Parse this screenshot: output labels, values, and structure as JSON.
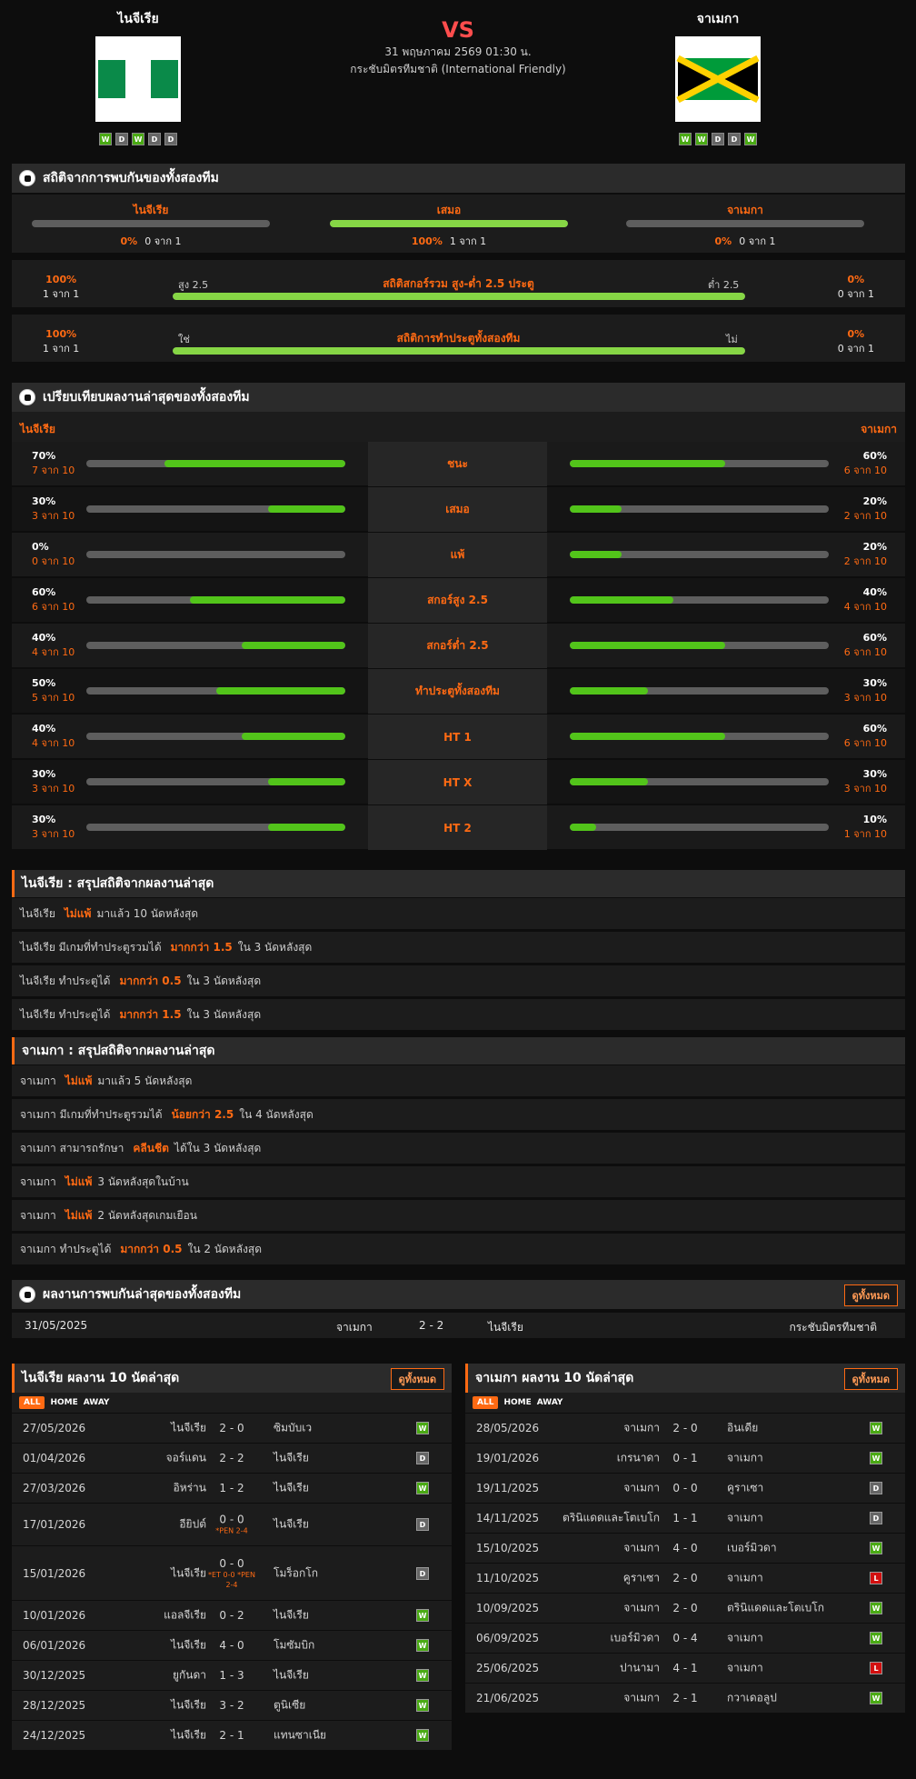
{
  "header": {
    "home": "ไนจีเรีย",
    "away": "จาเมกา",
    "vs": "VS",
    "date": "31 พฤษภาคม 2569 01:30 น.",
    "competition": "กระชับมิตรทีมชาติ (International Friendly)",
    "home_form": [
      "W",
      "D",
      "W",
      "D",
      "D"
    ],
    "away_form": [
      "W",
      "W",
      "D",
      "D",
      "W"
    ]
  },
  "h2h": {
    "title": "สถิติจากการพบกันของทั้งสองทีม",
    "cols": [
      {
        "label": "ไนจีเรีย",
        "pct": "0%",
        "cnt": "0 จาก 1",
        "val": 0
      },
      {
        "label": "เสมอ",
        "pct": "100%",
        "cnt": "1 จาก 1",
        "val": 100
      },
      {
        "label": "จาเมกา",
        "pct": "0%",
        "cnt": "0 จาก 1",
        "val": 0
      }
    ],
    "over": {
      "lpct": "100%",
      "lcnt": "1 จาก 1",
      "left": "สูง 2.5",
      "title": "สถิติสกอร์รวม สูง-ต่ำ 2.5 ประตู",
      "right": "ต่ำ 2.5",
      "rpct": "0%",
      "rcnt": "0 จาก 1",
      "val": 100
    },
    "btts": {
      "lpct": "100%",
      "lcnt": "1 จาก 1",
      "left": "ใช่",
      "title": "สถิติการทำประตูทั้งสองทีม",
      "right": "ไม่",
      "rpct": "0%",
      "rcnt": "0 จาก 1",
      "val": 100
    }
  },
  "compare": {
    "title": "เปรียบเทียบผลงานล่าสุดของทั้งสองทีม",
    "home": "ไนจีเรีย",
    "away": "จาเมกา",
    "rows": [
      {
        "label": "ชนะ",
        "lp": "70%",
        "lc": "7 จาก 10",
        "rp": "60%",
        "rc": "6 จาก 10",
        "lv": 70,
        "rv": 60
      },
      {
        "label": "เสมอ",
        "lp": "30%",
        "lc": "3 จาก 10",
        "rp": "20%",
        "rc": "2 จาก 10",
        "lv": 30,
        "rv": 20
      },
      {
        "label": "แพ้",
        "lp": "0%",
        "lc": "0 จาก 10",
        "rp": "20%",
        "rc": "2 จาก 10",
        "lv": 0,
        "rv": 20
      },
      {
        "label": "สกอร์สูง 2.5",
        "lp": "60%",
        "lc": "6 จาก 10",
        "rp": "40%",
        "rc": "4 จาก 10",
        "lv": 60,
        "rv": 40
      },
      {
        "label": "สกอร์ต่ำ 2.5",
        "lp": "40%",
        "lc": "4 จาก 10",
        "rp": "60%",
        "rc": "6 จาก 10",
        "lv": 40,
        "rv": 60
      },
      {
        "label": "ทำประตูทั้งสองทีม",
        "lp": "50%",
        "lc": "5 จาก 10",
        "rp": "30%",
        "rc": "3 จาก 10",
        "lv": 50,
        "rv": 30
      },
      {
        "label": "HT 1",
        "lp": "40%",
        "lc": "4 จาก 10",
        "rp": "60%",
        "rc": "6 จาก 10",
        "lv": 40,
        "rv": 60
      },
      {
        "label": "HT X",
        "lp": "30%",
        "lc": "3 จาก 10",
        "rp": "30%",
        "rc": "3 จาก 10",
        "lv": 30,
        "rv": 30
      },
      {
        "label": "HT 2",
        "lp": "30%",
        "lc": "3 จาก 10",
        "rp": "10%",
        "rc": "1 จาก 10",
        "lv": 30,
        "rv": 10
      }
    ]
  },
  "sum_home": {
    "title": "ไนจีเรีย : สรุปสถิติจากผลงานล่าสุด",
    "rows": [
      [
        "ไนจีเรีย",
        "ไม่แพ้",
        "มาแล้ว 10 นัดหลังสุด"
      ],
      [
        "ไนจีเรีย มีเกมที่ทำประตูรวมได้",
        "มากกว่า 1.5",
        "ใน 3 นัดหลังสุด"
      ],
      [
        "ไนจีเรีย ทำประตูได้",
        "มากกว่า 0.5",
        "ใน 3 นัดหลังสุด"
      ],
      [
        "ไนจีเรีย ทำประตูได้",
        "มากกว่า 1.5",
        "ใน 3 นัดหลังสุด"
      ]
    ]
  },
  "sum_away": {
    "title": "จาเมกา : สรุปสถิติจากผลงานล่าสุด",
    "rows": [
      [
        "จาเมกา",
        "ไม่แพ้",
        "มาแล้ว 5 นัดหลังสุด"
      ],
      [
        "จาเมกา มีเกมที่ทำประตูรวมได้",
        "น้อยกว่า 2.5",
        "ใน 4 นัดหลังสุด"
      ],
      [
        "จาเมกา สามารถรักษา",
        "คลีนชีต",
        "ได้ใน 3 นัดหลังสุด"
      ],
      [
        "จาเมกา",
        "ไม่แพ้",
        "3 นัดหลังสุดในบ้าน"
      ],
      [
        "จาเมกา",
        "ไม่แพ้",
        "2 นัดหลังสุดเกมเยือน"
      ],
      [
        "จาเมกา ทำประตูได้",
        "มากกว่า 0.5",
        "ใน 2 นัดหลังสุด"
      ]
    ]
  },
  "h2h_list": {
    "title": "ผลงานการพบกันล่าสุดของทั้งสองทีม",
    "view_all": "ดูทั้งหมด",
    "rows": [
      {
        "date": "31/05/2025",
        "home": "จาเมกา",
        "score": "2 - 2",
        "away": "ไนจีเรีย",
        "comp": "กระชับมิตรทีมชาติ"
      }
    ]
  },
  "home_list": {
    "title": "ไนจีเรีย ผลงาน 10 นัดล่าสุด",
    "view_all": "ดูทั้งหมด",
    "tabs": [
      "ALL",
      "HOME",
      "AWAY"
    ],
    "rows": [
      {
        "date": "27/05/2026",
        "home": "ไนจีเรีย",
        "score": "2 - 0",
        "away": "ซิมบับเว",
        "res": "W"
      },
      {
        "date": "01/04/2026",
        "home": "จอร์แดน",
        "score": "2 - 2",
        "away": "ไนจีเรีย",
        "res": "D"
      },
      {
        "date": "27/03/2026",
        "home": "อิหร่าน",
        "score": "1 - 2",
        "away": "ไนจีเรีย",
        "res": "W"
      },
      {
        "date": "17/01/2026",
        "home": "อียิปต์",
        "score": "0 - 0",
        "pen": "*PEN 2-4",
        "away": "ไนจีเรีย",
        "res": "D"
      },
      {
        "date": "15/01/2026",
        "home": "ไนจีเรีย",
        "score": "0 - 0",
        "pen": "*ET 0-0 *PEN 2-4",
        "away": "โมร็อกโก",
        "res": "D"
      },
      {
        "date": "10/01/2026",
        "home": "แอลจีเรีย",
        "score": "0 - 2",
        "away": "ไนจีเรีย",
        "res": "W"
      },
      {
        "date": "06/01/2026",
        "home": "ไนจีเรีย",
        "score": "4 - 0",
        "away": "โมซัมบิก",
        "res": "W"
      },
      {
        "date": "30/12/2025",
        "home": "ยูกันดา",
        "score": "1 - 3",
        "away": "ไนจีเรีย",
        "res": "W"
      },
      {
        "date": "28/12/2025",
        "home": "ไนจีเรีย",
        "score": "3 - 2",
        "away": "ตูนิเซีย",
        "res": "W"
      },
      {
        "date": "24/12/2025",
        "home": "ไนจีเรีย",
        "score": "2 - 1",
        "away": "แทนซาเนีย",
        "res": "W"
      }
    ]
  },
  "away_list": {
    "title": "จาเมกา ผลงาน 10 นัดล่าสุด",
    "view_all": "ดูทั้งหมด",
    "tabs": [
      "ALL",
      "HOME",
      "AWAY"
    ],
    "rows": [
      {
        "date": "28/05/2026",
        "home": "จาเมกา",
        "score": "2 - 0",
        "away": "อินเดีย",
        "res": "W"
      },
      {
        "date": "19/01/2026",
        "home": "เกรนาดา",
        "score": "0 - 1",
        "away": "จาเมกา",
        "res": "W"
      },
      {
        "date": "19/11/2025",
        "home": "จาเมกา",
        "score": "0 - 0",
        "away": "คูราเซา",
        "res": "D"
      },
      {
        "date": "14/11/2025",
        "home": "ตรินิแดดและโตเบโก",
        "score": "1 - 1",
        "away": "จาเมกา",
        "res": "D"
      },
      {
        "date": "15/10/2025",
        "home": "จาเมกา",
        "score": "4 - 0",
        "away": "เบอร์มิวดา",
        "res": "W"
      },
      {
        "date": "11/10/2025",
        "home": "คูราเซา",
        "score": "2 - 0",
        "away": "จาเมกา",
        "res": "L"
      },
      {
        "date": "10/09/2025",
        "home": "จาเมกา",
        "score": "2 - 0",
        "away": "ตรินิแดดและโตเบโก",
        "res": "W"
      },
      {
        "date": "06/09/2025",
        "home": "เบอร์มิวดา",
        "score": "0 - 4",
        "away": "จาเมกา",
        "res": "W"
      },
      {
        "date": "25/06/2025",
        "home": "ปานามา",
        "score": "4 - 1",
        "away": "จาเมกา",
        "res": "L"
      },
      {
        "date": "21/06/2025",
        "home": "จาเมกา",
        "score": "2 - 1",
        "away": "กวาเดอลูป",
        "res": "W"
      }
    ]
  }
}
